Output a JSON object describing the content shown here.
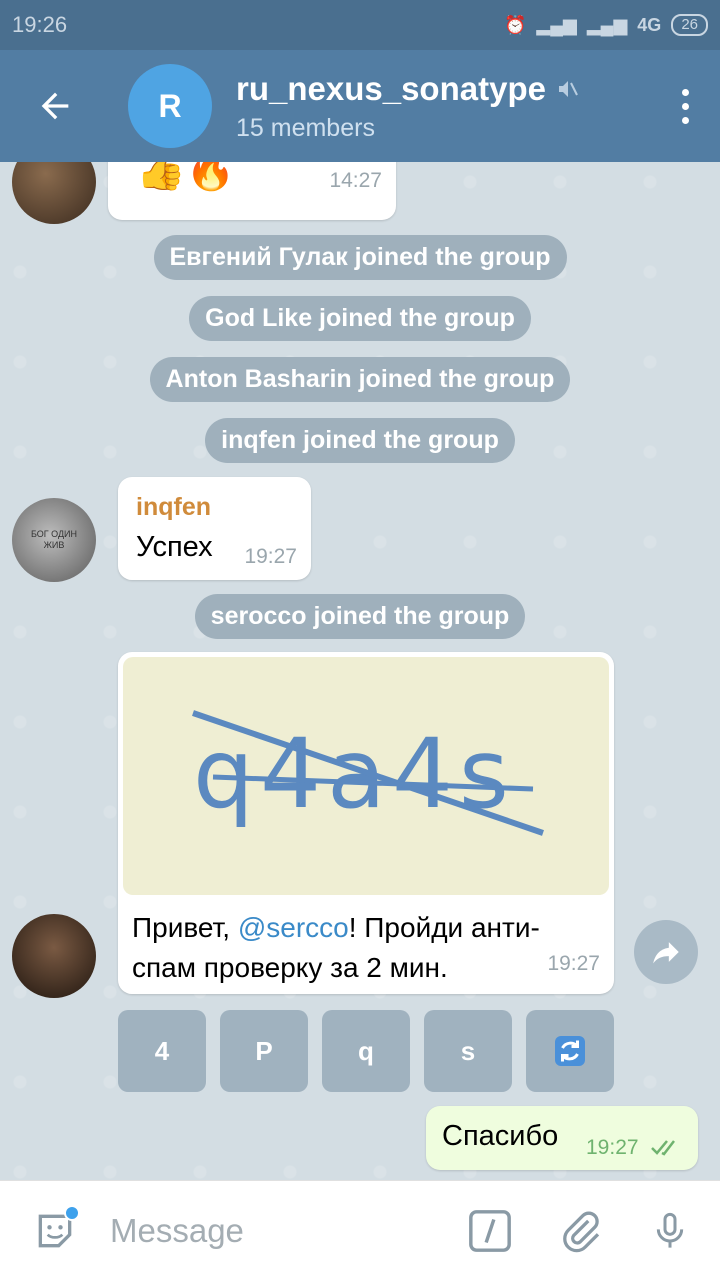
{
  "status_bar": {
    "time": "19:26",
    "network": "4G",
    "battery": "26"
  },
  "header": {
    "title": "ru_nexus_sonatype",
    "subtitle": "15 members",
    "avatar_letter": "R"
  },
  "messages": {
    "m1": {
      "emoji": "👍🔥",
      "time": "14:27"
    },
    "sys1": "Евгений Гулак joined the group",
    "sys2": "God Like joined the group",
    "sys3": "Anton Basharin joined the group",
    "sys4": "inqfen joined the group",
    "m2": {
      "sender": "inqfen",
      "text": "Успех",
      "time": "19:27",
      "avatar_text": "БОГ ОДИН ЖИВ"
    },
    "sys5": "serocco joined the group",
    "m3": {
      "captcha_text": "q4a4s",
      "text_before": "Привет, ",
      "mention": "@sercco",
      "line1_after": "! Пройди анти-",
      "line2": "спам проверку за 2 мин.",
      "time": "19:27"
    },
    "m4": {
      "text": "Спасибо",
      "time": "19:27"
    }
  },
  "captcha_buttons": [
    "4",
    "P",
    "q",
    "s"
  ],
  "input": {
    "placeholder": "Message"
  },
  "colors": {
    "header": "#527da3",
    "accent": "#4fa4e3",
    "outgoing": "#effdde",
    "sender": "#d08b3b",
    "link": "#3a8ac8"
  }
}
